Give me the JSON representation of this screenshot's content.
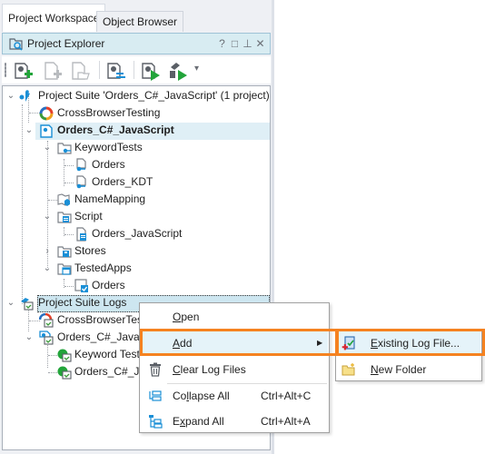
{
  "tabs": [
    {
      "label": "Project Workspace",
      "active": true
    },
    {
      "label": "Object Browser",
      "active": false
    }
  ],
  "panel": {
    "title": "Project Explorer",
    "header_buttons": [
      "help",
      "maximize",
      "pin",
      "close"
    ],
    "header_glyphs": {
      "help": "?",
      "maximize": "□",
      "pin": "⊥",
      "close": "✕"
    }
  },
  "toolbar": {
    "buttons": [
      {
        "name": "add-new-project-item",
        "enabled": true
      },
      {
        "name": "add-new-item",
        "enabled": false
      },
      {
        "name": "add-existing-item",
        "enabled": false
      },
      {
        "name": "project-properties",
        "enabled": true
      },
      {
        "name": "run-project",
        "enabled": true
      },
      {
        "name": "run-project-suite",
        "enabled": true
      }
    ],
    "dropdown_glyph": "▾"
  },
  "tree": [
    {
      "label": "Project Suite 'Orders_C#_JavaScript' (1 project)",
      "icon": "project-suite-icon",
      "level": 0,
      "expanded": true
    },
    {
      "label": "CrossBrowserTesting",
      "icon": "crossbrowsertesting-icon",
      "level": 1
    },
    {
      "label": "Orders_C#_JavaScript",
      "icon": "project-icon",
      "level": 1,
      "expanded": true,
      "bold": true,
      "selected": true
    },
    {
      "label": "KeywordTests",
      "icon": "keyword-folder-icon",
      "level": 2,
      "expanded": true
    },
    {
      "label": "Orders",
      "icon": "keyword-test-icon",
      "level": 3
    },
    {
      "label": "Orders_KDT",
      "icon": "keyword-test-icon",
      "level": 3
    },
    {
      "label": "NameMapping",
      "icon": "namemapping-icon",
      "level": 2
    },
    {
      "label": "Script",
      "icon": "script-folder-icon",
      "level": 2,
      "expanded": true
    },
    {
      "label": "Orders_JavaScript",
      "icon": "script-unit-icon",
      "level": 3
    },
    {
      "label": "Stores",
      "icon": "stores-folder-icon",
      "level": 2,
      "expanded": false
    },
    {
      "label": "TestedApps",
      "icon": "testedapps-folder-icon",
      "level": 2,
      "expanded": true
    },
    {
      "label": "Orders",
      "icon": "tested-app-icon",
      "level": 3
    },
    {
      "label": "Project Suite Logs",
      "icon": "suite-logs-icon",
      "level": 0,
      "expanded": true,
      "focused": true
    },
    {
      "label": "CrossBrowserTesting",
      "icon": "log-icon",
      "level": 1
    },
    {
      "label": "Orders_C#_JavaScript",
      "icon": "project-log-icon",
      "level": 1,
      "expanded": true
    },
    {
      "label": "Keyword Test Log",
      "icon": "log-success-icon",
      "level": 2
    },
    {
      "label": "Orders_C#_JavaScript",
      "icon": "log-success-icon",
      "level": 2
    }
  ],
  "context_menu": {
    "items": [
      {
        "label": "Open",
        "mnemonic": "O",
        "shortcut": "",
        "icon": ""
      },
      {
        "label": "Add",
        "mnemonic": "A",
        "shortcut": "",
        "submenu": true,
        "highlighted": true
      },
      {
        "label": "Clear Log Files",
        "mnemonic": "C",
        "shortcut": "",
        "icon": "trash-icon"
      },
      {
        "label": "Collapse All",
        "mnemonic": "l",
        "shortcut": "Ctrl+Alt+C",
        "icon": "collapse-all-icon"
      },
      {
        "label": "Expand All",
        "mnemonic": "x",
        "shortcut": "Ctrl+Alt+A",
        "icon": "expand-all-icon"
      }
    ],
    "submenu_arrow": "▶"
  },
  "submenu": {
    "items": [
      {
        "label": "Existing Log File...",
        "mnemonic": "E",
        "icon": "existing-log-file-icon",
        "highlighted": true
      },
      {
        "label": "New Folder",
        "mnemonic": "N",
        "icon": "new-folder-icon"
      }
    ]
  },
  "colors": {
    "highlight_outline": "#f58220",
    "selection": "#dfeff6",
    "header_bg": "#d8ecf2"
  }
}
